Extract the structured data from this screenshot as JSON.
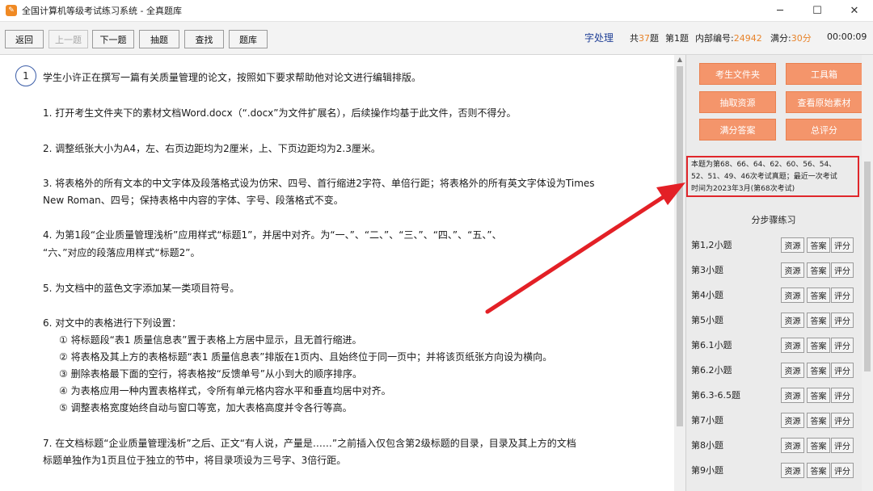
{
  "titlebar": {
    "title": "全国计算机等级考试练习系统 - 全真题库",
    "app_icon_glyph": "✎",
    "minimize": "─",
    "maximize": "☐",
    "close": "✕"
  },
  "toolbar": {
    "buttons": [
      "返回",
      "上一题",
      "下一题",
      "抽题",
      "查找",
      "题库"
    ],
    "subject": "字处理",
    "total_prefix": "共",
    "total_count": "37",
    "total_suffix": "题",
    "current": "第1题",
    "internal_label": "内部编号:",
    "internal_id": "24942",
    "full_label": "满分:",
    "full_score": "30分",
    "timer": "00:00:09"
  },
  "question": {
    "number": "1",
    "intro": "学生小许正在撰写一篇有关质量管理的论文，按照如下要求帮助他对论文进行编辑排版。",
    "items": [
      "1. 打开考生文件夹下的素材文档Word.docx（“.docx”为文件扩展名），后续操作均基于此文件，否则不得分。",
      "2. 调整纸张大小为A4，左、右页边距均为2厘米，上、下页边距均为2.3厘米。",
      "3. 将表格外的所有文本的中文字体及段落格式设为仿宋、四号、首行缩进2字符、单倍行距；将表格外的所有英文字体设为Times",
      "New Roman、四号；保持表格中内容的字体、字号、段落格式不变。",
      "4. 为第1段“企业质量管理浅析”应用样式“标题1”，并居中对齐。为“一、”、“二、”、“三、”、“四、”、“五、”、",
      "“六、”对应的段落应用样式“标题2”。",
      "5. 为文档中的蓝色文字添加某一类项目符号。",
      "6. 对文中的表格进行下列设置：",
      "7. 在文档标题“企业质量管理浅析”之后、正文“有人说，产量是……”之前插入仅包含第2级标题的目录，目录及其上方的文档",
      "标题单独作为1页且位于独立的节中，将目录项设为三号字、3倍行距。"
    ],
    "subitems": [
      "① 将标题段“表1 质量信息表”置于表格上方居中显示，且无首行缩进。",
      "② 将表格及其上方的表格标题“表1 质量信息表”排版在1页内、且始终位于同一页中；并将该页纸张方向设为横向。",
      "③ 删除表格最下面的空行，将表格按“反馈单号”从小到大的顺序排序。",
      "④ 为表格应用一种内置表格样式，令所有单元格内容水平和垂直均居中对齐。",
      "⑤ 调整表格宽度始终自动与窗口等宽，加大表格高度并令各行等高。"
    ]
  },
  "panel": {
    "buttons": [
      "考生文件夹",
      "工具箱",
      "抽取资源",
      "查看原始素材",
      "满分答案",
      "总评分"
    ],
    "history_lines": [
      "本题为第68、66、64、62、60、56、54、",
      "52、51、49、46次考试真题；最近一次考试",
      "时间为2023年3月(第68次考试)"
    ],
    "step_title": "分步骤练习",
    "steps": [
      "第1,2小题",
      "第3小题",
      "第4小题",
      "第5小题",
      "第6.1小题",
      "第6.2小题",
      "第6.3-6.5题",
      "第7小题",
      "第8小题",
      "第9小题"
    ],
    "step_buttons": [
      "资源",
      "答案",
      "评分"
    ]
  },
  "colors": {
    "accent_orange": "#f4956b",
    "highlight_red": "#e0262b",
    "subject_blue": "#1f3f96",
    "number_orange": "#e8832a"
  }
}
